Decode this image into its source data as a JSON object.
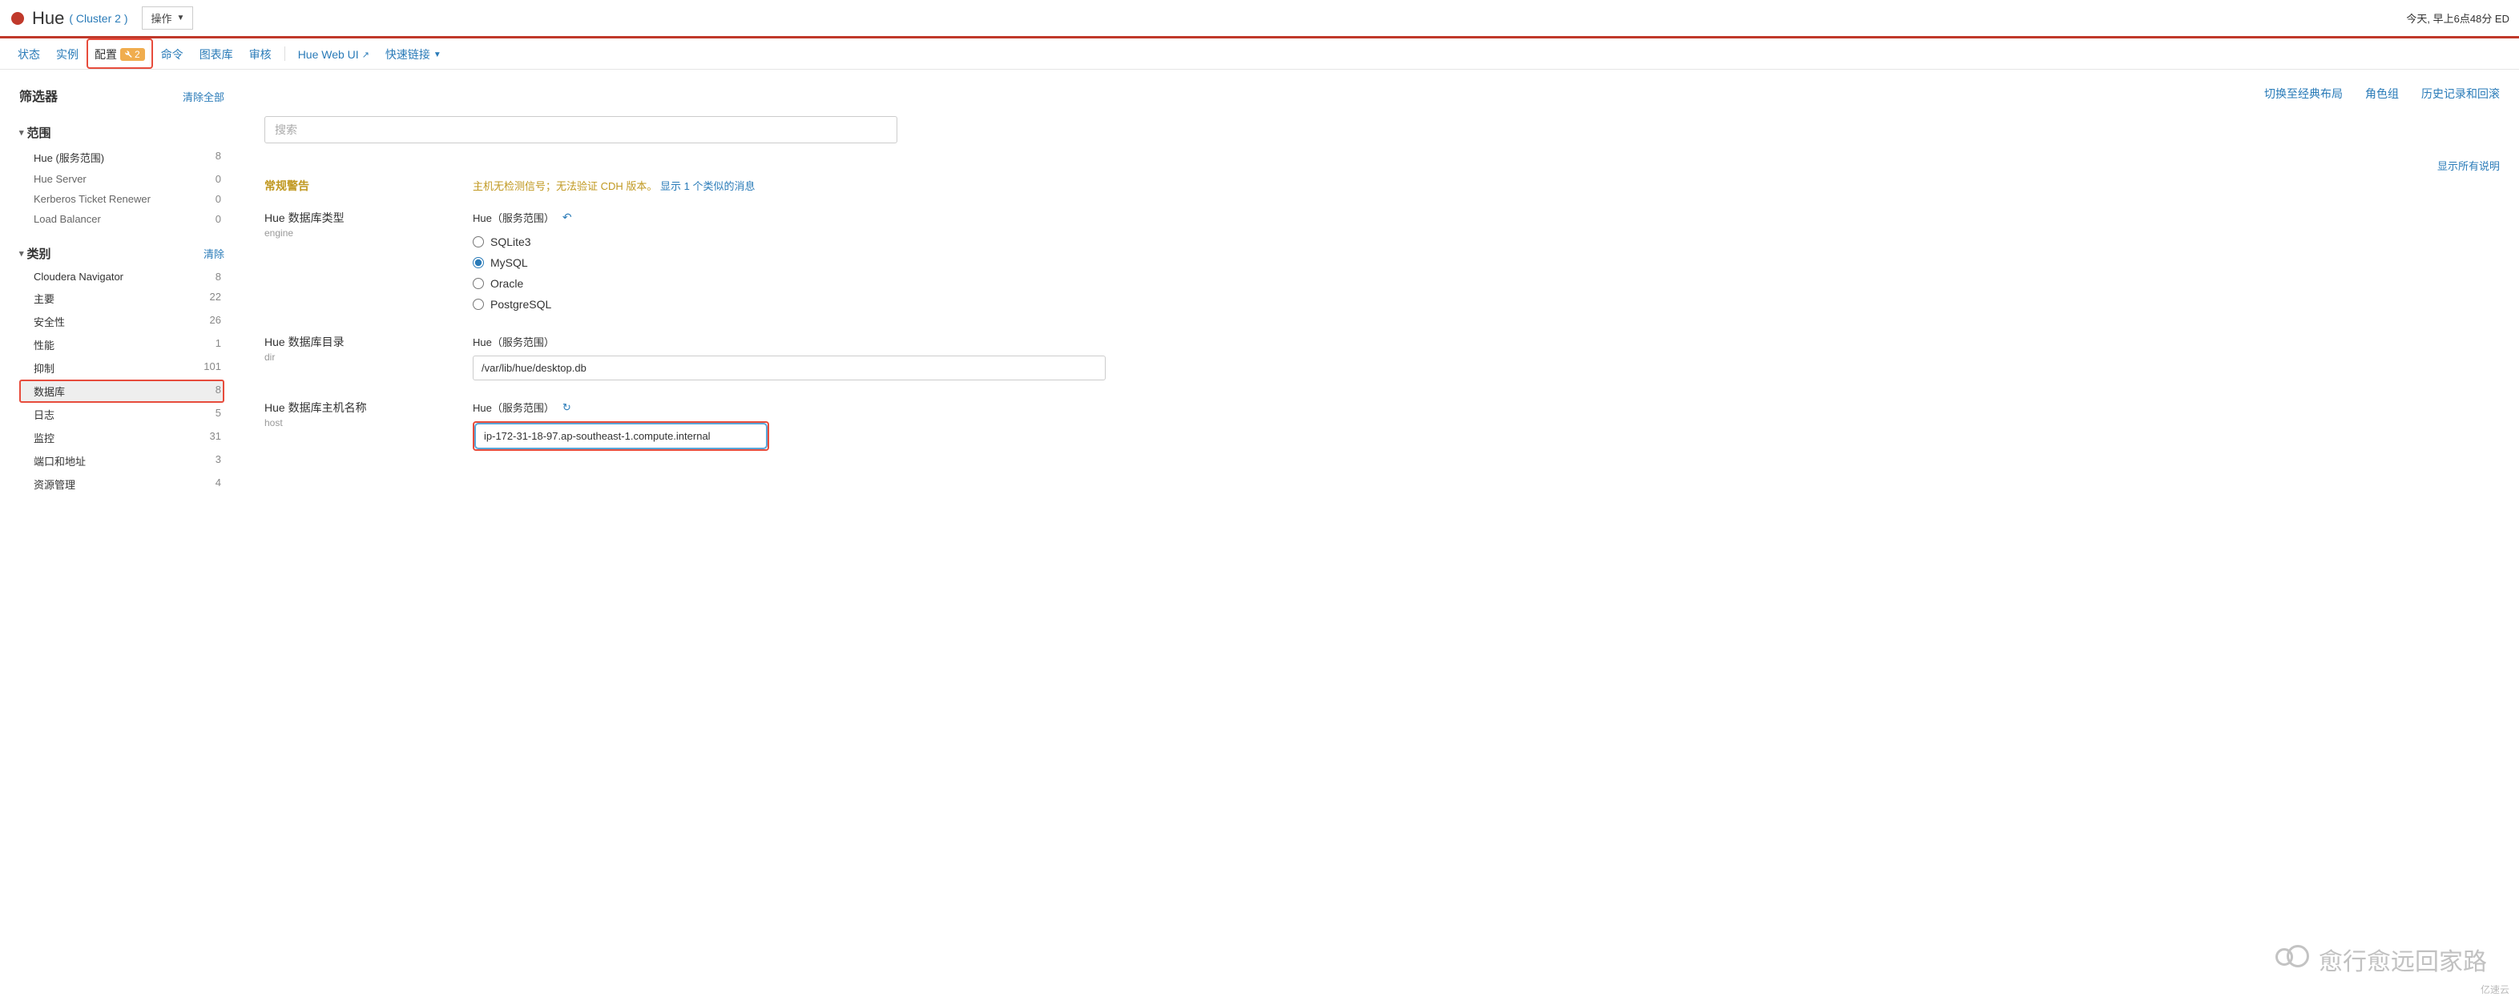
{
  "header": {
    "title": "Hue",
    "cluster": "( Cluster 2 )",
    "actions_label": "操作",
    "today": "今天, 早上6点48分 ED"
  },
  "tabs": {
    "status": "状态",
    "instances": "实例",
    "config": "配置",
    "config_badge": "2",
    "commands": "命令",
    "charts": "图表库",
    "audit": "审核",
    "webui": "Hue Web UI",
    "quick": "快速链接"
  },
  "top_links": {
    "classic": "切换至经典布局",
    "rolegroups": "角色组",
    "history": "历史记录和回滚"
  },
  "sidebar": {
    "filter_title": "筛选器",
    "clear_all": "清除全部",
    "scope_title": "范围",
    "scope_items": [
      {
        "label": "Hue (服务范围)",
        "count": "8",
        "dark": true
      },
      {
        "label": "Hue Server",
        "count": "0"
      },
      {
        "label": "Kerberos Ticket Renewer",
        "count": "0"
      },
      {
        "label": "Load Balancer",
        "count": "0"
      }
    ],
    "category_title": "类别",
    "category_clear": "清除",
    "category_items": [
      {
        "label": "Cloudera Navigator",
        "count": "8"
      },
      {
        "label": "主要",
        "count": "22"
      },
      {
        "label": "安全性",
        "count": "26"
      },
      {
        "label": "性能",
        "count": "1"
      },
      {
        "label": "抑制",
        "count": "101"
      },
      {
        "label": "数据库",
        "count": "8",
        "selected": true
      },
      {
        "label": "日志",
        "count": "5"
      },
      {
        "label": "监控",
        "count": "31"
      },
      {
        "label": "端口和地址",
        "count": "3"
      },
      {
        "label": "资源管理",
        "count": "4"
      }
    ]
  },
  "search": {
    "placeholder": "搜索"
  },
  "show_all": "显示所有说明",
  "warning": {
    "label": "常规警告",
    "text_a": "主机无检测信号；无法验证 CDH 版本。",
    "text_b": "显示 1 个类似的消息"
  },
  "config": {
    "scope_label": "Hue（服务范围）",
    "engine": {
      "name": "Hue 数据库类型",
      "sub": "engine",
      "options": [
        "SQLite3",
        "MySQL",
        "Oracle",
        "PostgreSQL"
      ],
      "selected": "MySQL"
    },
    "dir": {
      "name": "Hue 数据库目录",
      "sub": "dir",
      "value": "/var/lib/hue/desktop.db"
    },
    "host": {
      "name": "Hue 数据库主机名称",
      "sub": "host",
      "value": "ip-172-31-18-97.ap-southeast-1.compute.internal"
    }
  },
  "watermark": "愈行愈远回家路",
  "watermark2": "亿速云"
}
